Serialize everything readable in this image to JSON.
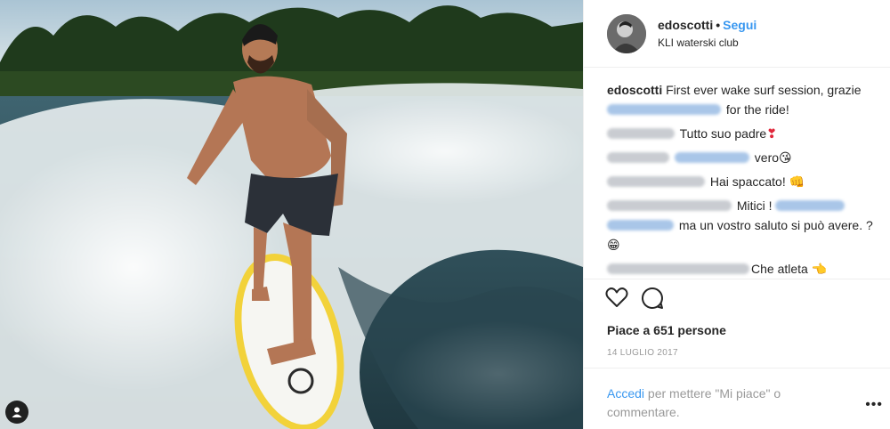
{
  "header": {
    "username": "edoscotti",
    "separator": "•",
    "follow_label": "Segui",
    "location": "KLI waterski club"
  },
  "caption": {
    "username": "edoscotti",
    "text_line1": "First ever wake surf session,",
    "text_prefix": "grazie",
    "text_suffix": "for the ride!"
  },
  "comments": [
    {
      "text": "Tutto suo padre",
      "emoji": "❣"
    },
    {
      "text": "vero",
      "emoji": "😘"
    },
    {
      "text": "Hai spaccato!",
      "emoji": "👊"
    },
    {
      "text": "Mitici !",
      "text2": "ma un vostro saluto si può avere. ?",
      "emoji": "😁"
    },
    {
      "text": "Che atleta",
      "emoji": "👈"
    }
  ],
  "likes": "Piace a 651 persone",
  "date": "14 LUGLIO 2017",
  "login": {
    "link": "Accedi",
    "text": "per mettere \"Mi piace\" o commentare."
  },
  "more_label": "•••",
  "icons": [
    "heart-icon",
    "comment-icon",
    "user-tag-icon",
    "more-icon"
  ],
  "colors": {
    "link": "#3897f0",
    "muted": "#999999",
    "text": "#262626"
  }
}
